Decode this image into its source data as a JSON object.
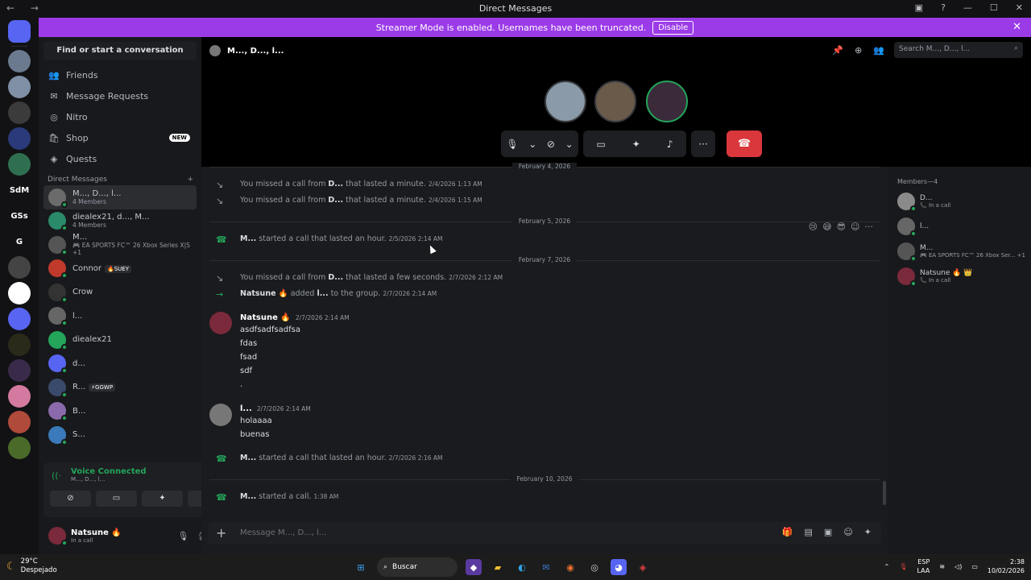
{
  "window": {
    "title": "Direct Messages",
    "nav": "← →"
  },
  "banner": {
    "text": "Streamer Mode is enabled. Usernames have been truncated.",
    "button": "Disable"
  },
  "guilds": [
    {
      "label": "",
      "color": "#5865f2"
    },
    {
      "label": "",
      "color": "#6b7a8f"
    },
    {
      "label": "",
      "color": "#7f8fa6"
    },
    {
      "label": "",
      "color": "#3b3b3b"
    },
    {
      "label": "",
      "color": "#2a3a7a"
    },
    {
      "label": "",
      "color": "#2f6f4f"
    },
    {
      "label": "SdM",
      "color": "#121214"
    },
    {
      "label": "GSs",
      "color": "#121214"
    },
    {
      "label": "G",
      "color": "#121214"
    },
    {
      "label": "",
      "color": "#444"
    },
    {
      "label": "",
      "color": "#ffffff"
    },
    {
      "label": "",
      "color": "#5865f2"
    },
    {
      "label": "",
      "color": "#2a2a1a"
    },
    {
      "label": "",
      "color": "#3a2a4a"
    },
    {
      "label": "",
      "color": "#d47aa0"
    },
    {
      "label": "",
      "color": "#b04a3a"
    },
    {
      "label": "",
      "color": "#4a6a2a"
    }
  ],
  "sidebar": {
    "find": "Find or start a conversation",
    "nav": [
      {
        "label": "Friends",
        "icon": "friends-icon"
      },
      {
        "label": "Message Requests",
        "icon": "mail-icon"
      },
      {
        "label": "Nitro",
        "icon": "nitro-icon"
      },
      {
        "label": "Shop",
        "icon": "shop-icon",
        "badge": "NEW"
      },
      {
        "label": "Quests",
        "icon": "quests-icon"
      }
    ],
    "dm_header": "Direct Messages",
    "dms": [
      {
        "name": "M..., D..., l...",
        "sub": "4 Members",
        "color": "#6b6b6b"
      },
      {
        "name": "diealex21, d..., M...",
        "sub": "4 Members",
        "color": "#2a8a6a"
      },
      {
        "name": "M...",
        "sub": "🎮 EA SPORTS FC™ 26 Xbox Series X|S +1",
        "color": "#555"
      },
      {
        "name": "Connor",
        "tag": "🔥SUEY",
        "color": "#c0392b"
      },
      {
        "name": "Crow",
        "color": "#333"
      },
      {
        "name": "l...",
        "color": "#666"
      },
      {
        "name": "diealex21",
        "color": "#23a55a"
      },
      {
        "name": "d...",
        "color": "#5865f2"
      },
      {
        "name": "R...",
        "tag": "⚡GGWP",
        "color": "#3a4a6a"
      },
      {
        "name": "B...",
        "color": "#8a6aaa"
      },
      {
        "name": "S...",
        "color": "#3a7aba"
      }
    ]
  },
  "voice": {
    "status": "Voice Connected",
    "channel": "M..., D..., l..."
  },
  "user": {
    "name": "Natsune 🔥",
    "status": "In a call"
  },
  "call": {
    "header": "M..., D..., l...",
    "search_placeholder": "Search M..., D..., l..."
  },
  "chat": {
    "dates": [
      "February 4, 2026",
      "February 5, 2026",
      "February 7, 2026",
      "February 10, 2026"
    ],
    "sys1": {
      "pre": "You missed a call from ",
      "who": "D...",
      "post": " that lasted a minute.",
      "time": "2/4/2026 1:13 AM"
    },
    "sys2": {
      "pre": "You missed a call from ",
      "who": "D...",
      "post": " that lasted a minute.",
      "time": "2/4/2026 1:15 AM"
    },
    "sys3": {
      "who": "M...",
      "post": " started a call that lasted an hour.",
      "time": "2/5/2026 2:14 AM"
    },
    "sys4": {
      "pre": "You missed a call from ",
      "who": "D...",
      "post": " that lasted a few seconds.",
      "time": "2/7/2026 2:12 AM"
    },
    "sys5": {
      "who": "Natsune 🔥",
      "mid": " added ",
      "who2": "l...",
      "post": " to the group.",
      "time": "2/7/2026 2:14 AM"
    },
    "msg1": {
      "author": "Natsune 🔥",
      "time": "2/7/2026 2:14 AM",
      "lines": [
        "asdfsadfsadfsa",
        "fdas",
        "fsad",
        "sdf",
        "."
      ]
    },
    "msg2": {
      "author": "l...",
      "time": "2/7/2026 2:14 AM",
      "lines": [
        "holaaaa",
        "buenas"
      ]
    },
    "sys6": {
      "who": "M...",
      "post": " started a call that lasted an hour.",
      "time": "2/7/2026 2:16 AM"
    },
    "sys7": {
      "who": "M...",
      "post": " started a call.",
      "time": "1:38 AM"
    },
    "composer_placeholder": "Message M..., D..., l..."
  },
  "members": {
    "header": "Members—4",
    "list": [
      {
        "name": "D...",
        "sub": "📞 In a call",
        "color": "#8a8a8a"
      },
      {
        "name": "l...",
        "sub": "",
        "color": "#666"
      },
      {
        "name": "M...",
        "sub": "🎮 EA SPORTS FC™ 26 Xbox Ser... +1",
        "color": "#555"
      },
      {
        "name": "Natsune 🔥 👑",
        "sub": "📞 In a call",
        "color": "#7a2a3a"
      }
    ]
  },
  "taskbar": {
    "temp": "29°C",
    "weather": "Despejado",
    "search": "Buscar",
    "lang": "ESP",
    "layout": "LAA",
    "time": "2:38",
    "date": "10/02/2026"
  }
}
